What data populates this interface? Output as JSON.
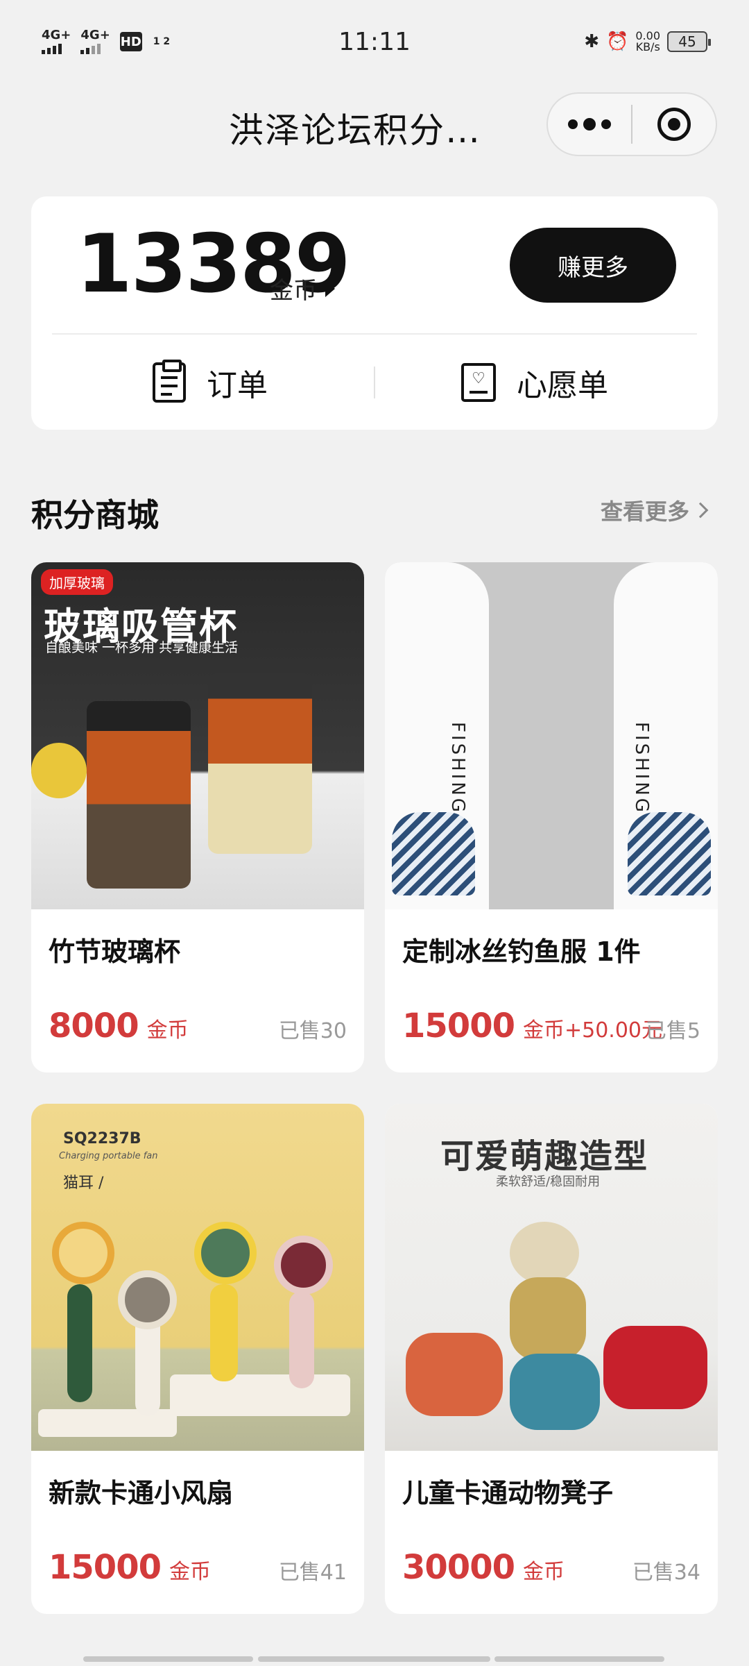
{
  "status_bar": {
    "sim1": "4G+",
    "sim2": "4G+",
    "hd": "HD",
    "hd_sub": "1 2",
    "time": "11:11",
    "speed": "0.00",
    "speed_unit": "KB/s",
    "battery": "45"
  },
  "nav": {
    "title": "洪泽论坛积分…"
  },
  "points": {
    "amount": "13389",
    "unit": "金币",
    "earn_label": "赚更多",
    "orders_label": "订单",
    "wishlist_label": "心愿单"
  },
  "section": {
    "title": "积分商城",
    "see_more": "查看更多"
  },
  "products": [
    {
      "name": "竹节玻璃杯",
      "price": "8000",
      "unit": "金币",
      "sold": "已售30",
      "img_tag": "加厚玻璃",
      "img_heading": "玻璃吸管杯",
      "img_sub": "自酿美味 一杯多用 共享健康生活"
    },
    {
      "name": "定制冰丝钓鱼服 1件",
      "price": "15000",
      "unit": "金币+50.00元",
      "sold": "已售5",
      "img_text_left": "FISHING",
      "img_text_right": "FISHING"
    },
    {
      "name": "新款卡通小风扇",
      "price": "15000",
      "unit": "金币",
      "sold": "已售41",
      "img_model": "SQ2237B",
      "img_model_sub": "Charging portable fan",
      "img_variant": "猫耳 /"
    },
    {
      "name": "儿童卡通动物凳子",
      "price": "30000",
      "unit": "金币",
      "sold": "已售34",
      "img_heading": "可爱萌趣造型",
      "img_sub": "柔软舒适/稳固耐用"
    }
  ],
  "colors": {
    "price_red": "#d23b3b",
    "primary_black": "#111111",
    "page_bg": "#f1f1f1"
  }
}
